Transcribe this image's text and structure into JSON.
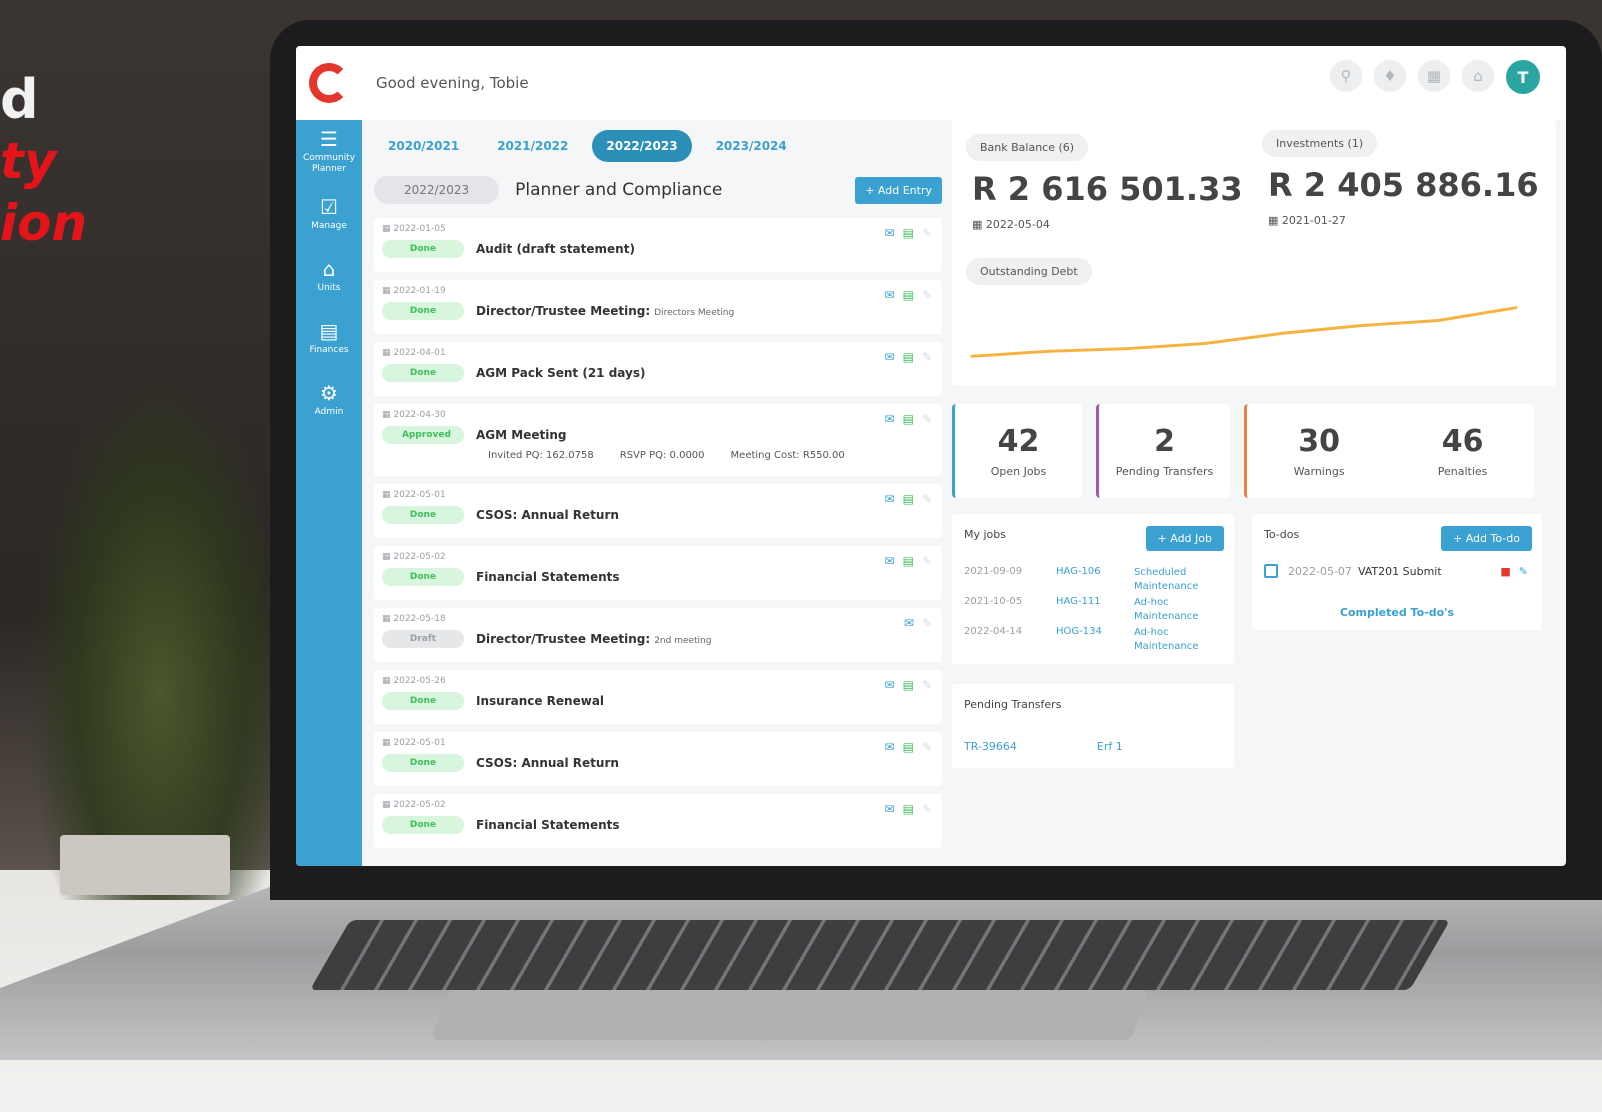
{
  "promo": {
    "line1": "d",
    "line2": "ty",
    "line3": "ion"
  },
  "app": {
    "greeting": "Good evening, Tobie",
    "avatar_initial": "T",
    "brand_color": "#3aa1d1"
  },
  "topbar": {
    "icons": [
      "search-icon",
      "bell-icon",
      "calendar-icon",
      "home-icon"
    ]
  },
  "sidebar": {
    "items": [
      {
        "label": "Community Planner",
        "icon": "list-icon"
      },
      {
        "label": "Manage",
        "icon": "clipboard-check-icon"
      },
      {
        "label": "Units",
        "icon": "home-icon"
      },
      {
        "label": "Finances",
        "icon": "invoice-icon"
      },
      {
        "label": "Admin",
        "icon": "gear-icon"
      }
    ]
  },
  "years": [
    "2020/2021",
    "2021/2022",
    "2022/2023",
    "2023/2024"
  ],
  "active_year": "2022/2023",
  "planner": {
    "year_pill": "2022/2023",
    "title": "Planner and Compliance",
    "add_entry_label": "+ Add Entry"
  },
  "entries": [
    {
      "date": "2022-01-05",
      "status": "Done",
      "title": "Audit (draft statement)",
      "sub": ""
    },
    {
      "date": "2022-01-19",
      "status": "Done",
      "title": "Director/Trustee Meeting:",
      "sub": "Directors Meeting"
    },
    {
      "date": "2022-04-01",
      "status": "Done",
      "title": "AGM Pack Sent (21 days)",
      "sub": ""
    },
    {
      "date": "2022-04-30",
      "status": "Approved",
      "title": "AGM Meeting",
      "sub": "",
      "invited": "Invited PQ: 162.0758",
      "rsvp": "RSVP PQ: 0.0000",
      "cost": "Meeting Cost: R550.00"
    },
    {
      "date": "2022-05-01",
      "status": "Done",
      "title": "CSOS: Annual Return",
      "sub": ""
    },
    {
      "date": "2022-05-02",
      "status": "Done",
      "title": "Financial Statements",
      "sub": ""
    },
    {
      "date": "2022-05-18",
      "status": "Draft",
      "title": "Director/Trustee Meeting:",
      "sub": "2nd meeting"
    },
    {
      "date": "2022-05-26",
      "status": "Done",
      "title": "Insurance Renewal",
      "sub": ""
    },
    {
      "date": "2022-05-01",
      "status": "Done",
      "title": "CSOS: Annual Return",
      "sub": ""
    },
    {
      "date": "2022-05-02",
      "status": "Done",
      "title": "Financial Statements",
      "sub": ""
    }
  ],
  "finance": {
    "bank_label": "Bank Balance (6)",
    "bank_amount": "R 2 616 501.33",
    "bank_date": "2022-05-04",
    "invest_label": "Investments (1)",
    "invest_amount": "R 2 405 886.16",
    "invest_date": "2021-01-27",
    "debt_label": "Outstanding Debt",
    "debt_line_color": "#f5b342"
  },
  "chart_data": {
    "type": "line",
    "series": [
      {
        "values": [
          0.12,
          0.2,
          0.24,
          0.32,
          0.48,
          0.6,
          0.68,
          0.88
        ]
      }
    ]
  },
  "stats": [
    {
      "value": "42",
      "label": "Open Jobs",
      "color": "#3aa1d1"
    },
    {
      "value": "2",
      "label": "Pending Transfers",
      "color": "#9b59b6"
    },
    {
      "value": "30",
      "label": "Warnings",
      "color": "#e8823a"
    },
    {
      "value": "46",
      "label": "Penalties",
      "color": "#e8823a"
    }
  ],
  "jobs": {
    "title": "My jobs",
    "add_label": "+ Add Job",
    "rows": [
      {
        "date": "2021-09-09",
        "code": "HAG-106",
        "type": "Scheduled Maintenance"
      },
      {
        "date": "2021-10-05",
        "code": "HAG-111",
        "type": "Ad-hoc Maintenance"
      },
      {
        "date": "2022-04-14",
        "code": "HOG-134",
        "type": "Ad-hoc Maintenance"
      }
    ]
  },
  "todos": {
    "title": "To-dos",
    "add_label": "+ Add To-do",
    "items": [
      {
        "date": "2022-05-07",
        "text": "VAT201 Submit"
      }
    ],
    "completed_link": "Completed To-do's"
  },
  "transfers": {
    "title": "Pending Transfers",
    "rows": [
      {
        "code": "TR-39664",
        "erf": "Erf 1"
      }
    ]
  }
}
